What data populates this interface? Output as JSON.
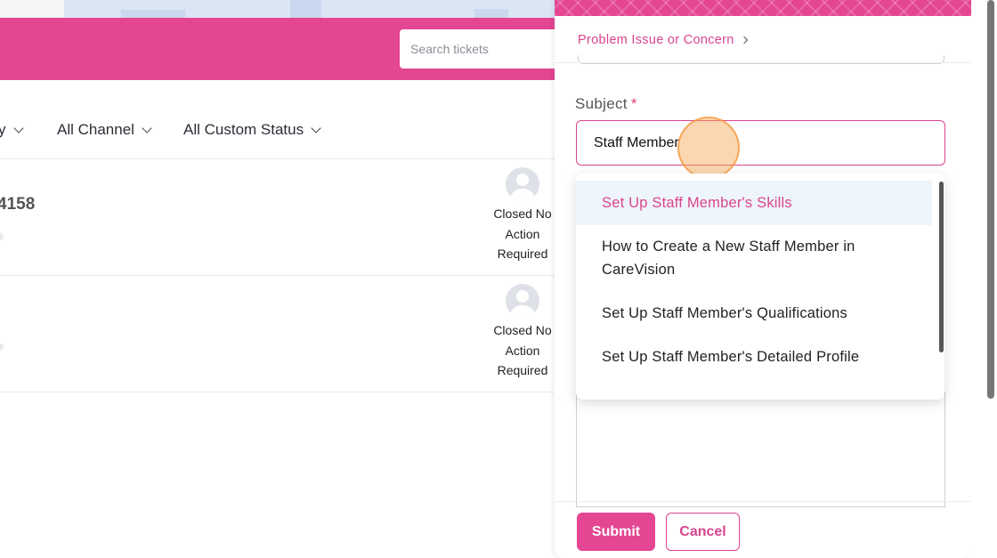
{
  "header": {
    "search_placeholder": "Search tickets"
  },
  "filters": [
    {
      "label": "y"
    },
    {
      "label": "All Channel"
    },
    {
      "label": "All Custom Status"
    }
  ],
  "tickets": [
    {
      "number": "4158",
      "status": [
        "Closed No",
        "Action",
        "Required"
      ]
    },
    {
      "number": "",
      "status": [
        "Closed No",
        "Action",
        "Required"
      ]
    }
  ],
  "panel": {
    "breadcrumb": "Problem Issue or Concern",
    "subject_label": "Subject",
    "required_mark": "*",
    "subject_value": "Staff Member",
    "suggestions": [
      "Set Up Staff Member's Skills",
      "How to Create a New Staff Member in CareVision",
      "Set Up Staff Member's Qualifications",
      "Set Up Staff Member's Detailed Profile"
    ],
    "submit_label": "Submit",
    "cancel_label": "Cancel"
  },
  "colors": {
    "brand": "#e44692",
    "accent_text": "#d9458e"
  }
}
